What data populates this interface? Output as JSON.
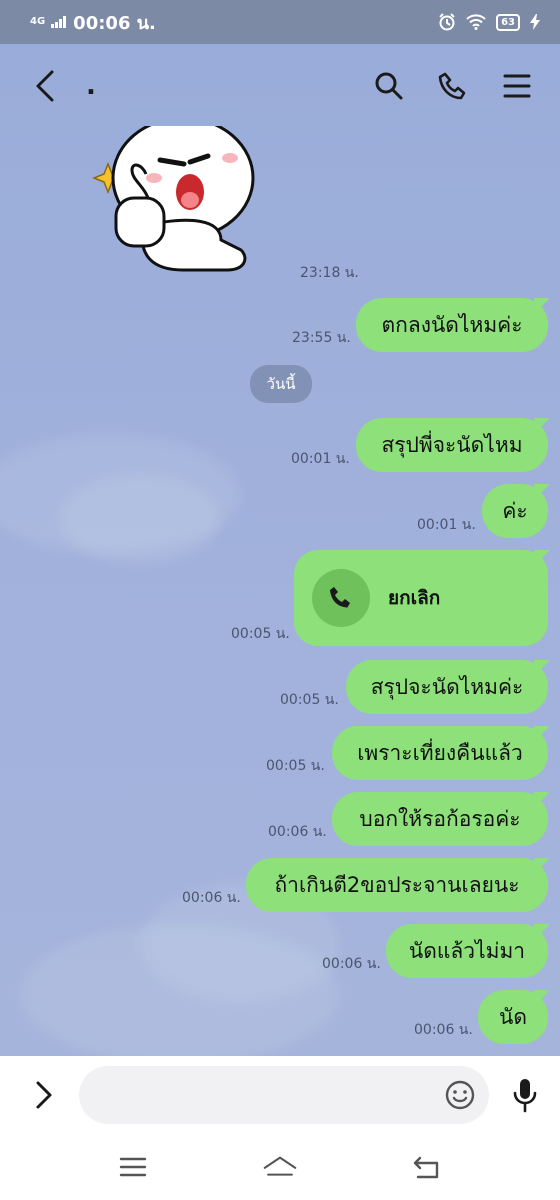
{
  "status_bar": {
    "network": "4G",
    "time": "00:06 น.",
    "battery": "63"
  },
  "header": {
    "title": "."
  },
  "messages": [
    {
      "time": "23:18 น."
    },
    {
      "text": "ตกลงนัดไหมค่ะ",
      "time": "23:55 น."
    },
    {
      "text": "สรุปพี่จะนัดไหม",
      "time": "00:01 น."
    },
    {
      "text": "ค่ะ",
      "time": "00:01 น."
    },
    {
      "text": "สรุปจะนัดไหมค่ะ",
      "time": "00:05 น."
    },
    {
      "text": "เพราะเที่ยงคืนแล้ว",
      "time": "00:05 น."
    },
    {
      "text": "บอกให้รอก้อรอค่ะ",
      "time": "00:06 น."
    },
    {
      "text": "ถ้าเกินตี2ขอประจานเลยนะ",
      "time": "00:06 น."
    },
    {
      "text": "นัดแล้วไม่มา",
      "time": "00:06 น."
    },
    {
      "text": "นัด",
      "time": "00:06 น."
    }
  ],
  "date_divider": "วันนี้",
  "call": {
    "label": "ยกเลิก",
    "time": "00:05 น."
  },
  "input": {
    "placeholder": "",
    "value": ""
  },
  "colors": {
    "bubble": "#8de07a",
    "chat_background": "#9fb0d8",
    "status_bar": "#7d8aa6"
  },
  "icons": [
    "back-icon",
    "search-icon",
    "phone-icon",
    "menu-icon",
    "expand-icon",
    "emoji-icon",
    "mic-icon",
    "nav-menu-icon",
    "nav-home-icon",
    "nav-back-icon",
    "call-icon"
  ]
}
